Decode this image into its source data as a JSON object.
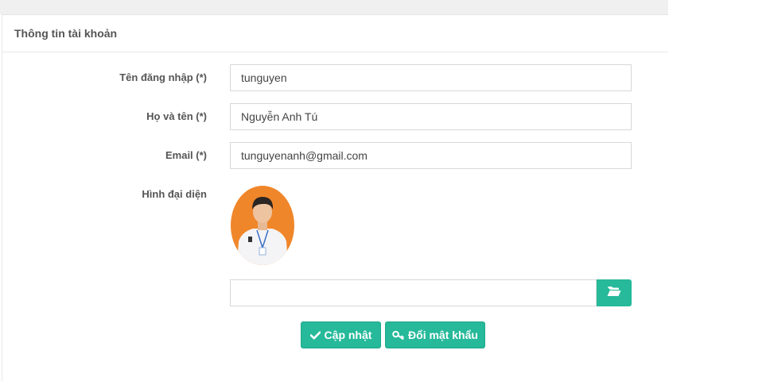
{
  "panel": {
    "title": "Thông tin tài khoản"
  },
  "form": {
    "username": {
      "label": "Tên đăng nhập (*)",
      "value": "tunguyen"
    },
    "fullname": {
      "label": "Họ và tên (*)",
      "value": "Nguyễn Anh Tú"
    },
    "email": {
      "label": "Email (*)",
      "value": "tunguyenanh@gmail.com"
    },
    "avatar": {
      "label": "Hình đại diện",
      "file_value": ""
    }
  },
  "buttons": {
    "update": "Cập nhật",
    "change_password": "Đổi mật khẩu"
  },
  "colors": {
    "accent": "#26b99a",
    "avatar_background": "#f0862a"
  },
  "icons": {
    "browse": "folder-open-icon",
    "update": "check-icon",
    "change_password": "key-icon"
  }
}
